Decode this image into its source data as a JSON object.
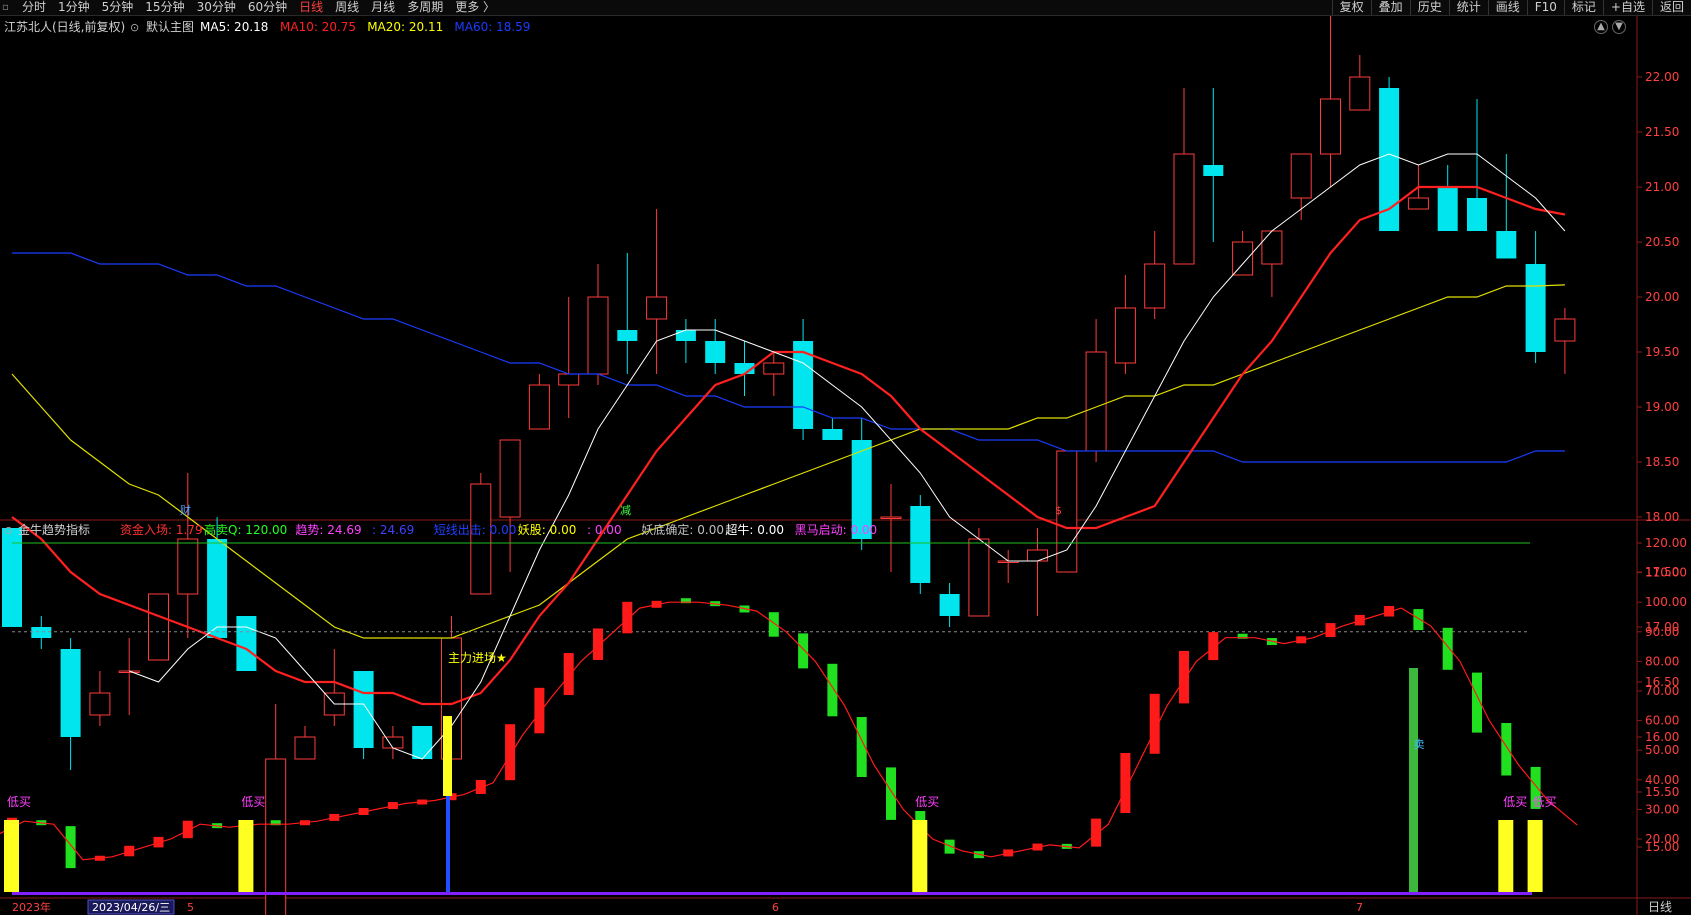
{
  "toolbar": {
    "tabs": [
      "分时",
      "1分钟",
      "5分钟",
      "15分钟",
      "30分钟",
      "60分钟",
      "日线",
      "周线",
      "月线",
      "多周期",
      "更多 〉"
    ],
    "active": "日线",
    "right": [
      "复权",
      "叠加",
      "历史",
      "统计",
      "画线",
      "F10",
      "标记",
      "+自选",
      "返回"
    ]
  },
  "main_header": {
    "stock": "江苏北人(日线,前复权)",
    "chart_name": "默认主图",
    "ma": [
      {
        "label": "MA5: 20.18",
        "color": "#ffffff"
      },
      {
        "label": "MA10: 20.75",
        "color": "#ff2020"
      },
      {
        "label": "MA20: 20.11",
        "color": "#ffff00"
      },
      {
        "label": "MA60: 18.59",
        "color": "#1a3cff"
      }
    ]
  },
  "price_axis": [
    "22.00",
    "21.50",
    "21.00",
    "20.50",
    "20.00",
    "19.50",
    "19.00",
    "18.50",
    "18.00",
    "17.50",
    "17.00",
    "16.50",
    "16.00",
    "15.50",
    "15.00"
  ],
  "annotations": {
    "high": "22.65",
    "low": "14.30",
    "event_1": "财",
    "event_2": "减",
    "event_3": "$"
  },
  "ind_header": {
    "name": "金牛趋势指标",
    "items": [
      {
        "label": "资金入场: 1.79",
        "color": "#ff3030"
      },
      {
        "label": "高卖Q: 120.00",
        "color": "#20ff20"
      },
      {
        "label": "趋势: 24.69",
        "color": "#ff40ff"
      },
      {
        "label": ": 24.69",
        "color": "#4040ff"
      },
      {
        "label": "短线出击: 0.00",
        "color": "#2040ff"
      },
      {
        "label": "妖股: 0.00",
        "color": "#ffff00"
      },
      {
        "label": ": 0.00",
        "color": "#ff40ff"
      },
      {
        "label": "妖底确定: 0.00",
        "color": "#c0c0c0"
      },
      {
        "label": "超牛: 0.00",
        "color": "#ffffff"
      },
      {
        "label": "黑马启动: 0.00",
        "color": "#ff40ff"
      }
    ]
  },
  "ind_axis": [
    "120.00",
    "110.00",
    "100.00",
    "90.00",
    "80.00",
    "70.00",
    "60.00",
    "50.00",
    "40.00",
    "30.00",
    "20.00"
  ],
  "ind_labels": {
    "low_buy": "低买",
    "main_force": "主力进场★",
    "sell": "卖"
  },
  "bottom": {
    "year": "2023年",
    "date": "2023/04/26/三",
    "m5": "5",
    "m6": "6",
    "m7": "7",
    "period": "日线"
  },
  "chart_data": [
    {
      "type": "candlestick",
      "title": "江苏北人(日线,前复权)",
      "ohlc": [
        [
          17.9,
          17.9,
          17.0,
          17.0
        ],
        [
          17.0,
          17.1,
          16.8,
          16.9
        ],
        [
          16.8,
          16.9,
          15.7,
          16.0
        ],
        [
          16.2,
          16.6,
          16.1,
          16.4
        ],
        [
          16.6,
          16.9,
          16.2,
          16.6
        ],
        [
          16.7,
          17.3,
          16.7,
          17.3
        ],
        [
          17.3,
          18.4,
          16.9,
          17.8
        ],
        [
          17.8,
          18.0,
          16.9,
          16.9
        ],
        [
          17.1,
          17.1,
          16.6,
          16.6
        ],
        [
          14.3,
          16.3,
          14.3,
          15.8
        ],
        [
          15.8,
          16.1,
          15.8,
          16.0
        ],
        [
          16.2,
          16.8,
          16.1,
          16.4
        ],
        [
          16.6,
          16.6,
          15.8,
          15.9
        ],
        [
          15.9,
          16.1,
          15.8,
          16.0
        ],
        [
          16.1,
          16.1,
          15.8,
          15.8
        ],
        [
          15.8,
          17.1,
          15.8,
          16.9
        ],
        [
          17.3,
          18.4,
          17.3,
          18.3
        ],
        [
          18.0,
          18.7,
          17.5,
          18.7
        ],
        [
          18.8,
          19.3,
          18.8,
          19.2
        ],
        [
          19.2,
          20.0,
          18.9,
          19.3
        ],
        [
          19.3,
          20.3,
          19.2,
          20.0
        ],
        [
          19.7,
          20.4,
          19.3,
          19.6
        ],
        [
          19.8,
          20.8,
          19.3,
          20.0
        ],
        [
          19.7,
          19.8,
          19.4,
          19.6
        ],
        [
          19.6,
          19.8,
          19.3,
          19.4
        ],
        [
          19.4,
          19.6,
          19.1,
          19.3
        ],
        [
          19.3,
          19.5,
          19.1,
          19.4
        ],
        [
          19.6,
          19.8,
          18.7,
          18.8
        ],
        [
          18.8,
          18.9,
          18.7,
          18.7
        ],
        [
          18.7,
          18.9,
          17.7,
          17.8
        ],
        [
          18.0,
          18.3,
          17.5,
          18.0
        ],
        [
          18.1,
          18.2,
          17.3,
          17.4
        ],
        [
          17.3,
          17.4,
          17.0,
          17.1
        ],
        [
          17.1,
          17.9,
          17.1,
          17.8
        ],
        [
          17.6,
          17.7,
          17.4,
          17.6
        ],
        [
          17.6,
          17.9,
          17.1,
          17.7
        ],
        [
          17.5,
          18.6,
          17.5,
          18.6
        ],
        [
          18.6,
          19.8,
          18.5,
          19.5
        ],
        [
          19.4,
          20.2,
          19.3,
          19.9
        ],
        [
          19.9,
          20.6,
          19.8,
          20.3
        ],
        [
          20.3,
          21.9,
          20.3,
          21.3
        ],
        [
          21.2,
          21.9,
          20.5,
          21.1
        ],
        [
          20.2,
          20.6,
          20.2,
          20.5
        ],
        [
          20.3,
          20.6,
          20.0,
          20.6
        ],
        [
          20.9,
          21.3,
          20.7,
          21.3
        ],
        [
          21.3,
          22.65,
          21.0,
          21.8
        ],
        [
          21.7,
          22.2,
          21.7,
          22.0
        ],
        [
          21.9,
          22.0,
          20.6,
          20.6
        ],
        [
          20.8,
          21.2,
          20.8,
          20.9
        ],
        [
          21.0,
          21.2,
          20.6,
          20.6
        ],
        [
          20.9,
          21.8,
          20.6,
          20.6
        ],
        [
          20.6,
          21.3,
          20.6,
          20.35
        ],
        [
          20.3,
          20.6,
          19.4,
          19.5
        ],
        [
          19.6,
          19.9,
          19.3,
          19.8
        ]
      ],
      "ma5": [
        null,
        null,
        null,
        null,
        16.6,
        16.5,
        16.8,
        17.0,
        17.0,
        16.9,
        16.6,
        16.3,
        16.3,
        15.9,
        15.8,
        16.1,
        16.5,
        17.1,
        17.7,
        18.2,
        18.8,
        19.2,
        19.6,
        19.7,
        19.7,
        19.6,
        19.5,
        19.4,
        19.2,
        19.0,
        18.7,
        18.4,
        18.0,
        17.8,
        17.6,
        17.6,
        17.7,
        18.1,
        18.6,
        19.1,
        19.6,
        20.0,
        20.3,
        20.6,
        20.8,
        21.0,
        21.2,
        21.3,
        21.2,
        21.3,
        21.3,
        21.1,
        20.9,
        20.6
      ],
      "ma10": [
        18.0,
        17.8,
        17.5,
        17.3,
        17.2,
        17.1,
        17.0,
        16.9,
        16.8,
        16.6,
        16.5,
        16.5,
        16.4,
        16.4,
        16.3,
        16.3,
        16.4,
        16.7,
        17.1,
        17.4,
        17.8,
        18.2,
        18.6,
        18.9,
        19.2,
        19.3,
        19.5,
        19.5,
        19.4,
        19.3,
        19.1,
        18.8,
        18.6,
        18.4,
        18.2,
        18.0,
        17.9,
        17.9,
        18.0,
        18.1,
        18.5,
        18.9,
        19.3,
        19.6,
        20.0,
        20.4,
        20.7,
        20.8,
        21.0,
        21.0,
        21.0,
        20.9,
        20.8,
        20.75
      ],
      "ma20": [
        19.3,
        19.0,
        18.7,
        18.5,
        18.3,
        18.2,
        18.0,
        17.8,
        17.6,
        17.4,
        17.2,
        17.0,
        16.9,
        16.9,
        16.9,
        16.9,
        17.0,
        17.1,
        17.2,
        17.4,
        17.6,
        17.8,
        17.9,
        18.0,
        18.1,
        18.2,
        18.3,
        18.4,
        18.5,
        18.6,
        18.7,
        18.8,
        18.8,
        18.8,
        18.8,
        18.9,
        18.9,
        19.0,
        19.1,
        19.1,
        19.2,
        19.2,
        19.3,
        19.4,
        19.5,
        19.6,
        19.7,
        19.8,
        19.9,
        20.0,
        20.0,
        20.1,
        20.1,
        20.11
      ],
      "ma60": [
        20.4,
        20.4,
        20.4,
        20.3,
        20.3,
        20.3,
        20.2,
        20.2,
        20.1,
        20.1,
        20.0,
        19.9,
        19.8,
        19.8,
        19.7,
        19.6,
        19.5,
        19.4,
        19.4,
        19.3,
        19.3,
        19.2,
        19.2,
        19.1,
        19.1,
        19.0,
        19.0,
        19.0,
        18.9,
        18.9,
        18.8,
        18.8,
        18.8,
        18.7,
        18.7,
        18.7,
        18.6,
        18.6,
        18.6,
        18.6,
        18.6,
        18.6,
        18.5,
        18.5,
        18.5,
        18.5,
        18.5,
        18.5,
        18.5,
        18.5,
        18.5,
        18.5,
        18.6,
        18.6
      ]
    },
    {
      "type": "bar",
      "title": "金牛趋势指标",
      "trend": [
        21,
        26,
        25,
        13,
        14,
        17,
        20,
        25,
        24,
        25,
        25,
        26,
        28,
        30,
        32,
        33,
        35,
        39,
        55,
        68,
        80,
        89,
        98,
        100,
        100,
        99,
        97,
        90,
        80,
        65,
        45,
        30,
        20,
        16,
        14,
        16,
        18,
        17,
        25,
        45,
        65,
        80,
        88,
        88,
        86,
        88,
        92,
        95,
        98,
        92,
        80,
        60,
        45,
        33,
        24.69
      ],
      "ylim": [
        0,
        120
      ],
      "reference": [
        90,
        120
      ]
    }
  ]
}
